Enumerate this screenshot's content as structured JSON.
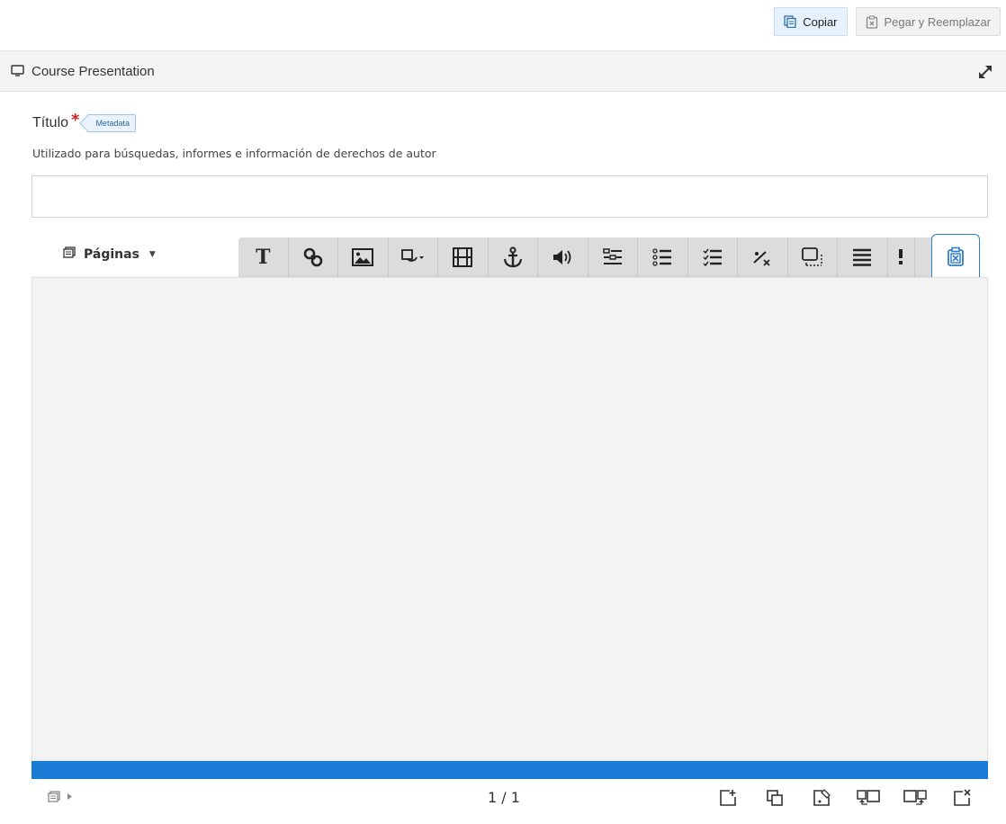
{
  "top_actions": {
    "copy_label": "Copiar",
    "paste_label": "Pegar y Reemplazar"
  },
  "header": {
    "title": "Course Presentation",
    "icon": "monitor-icon",
    "fullscreen_icon": "expand-icon"
  },
  "title_field": {
    "label": "Título",
    "required_mark": "*",
    "metadata_label": "Metadata",
    "description": "Utilizado para búsquedas, informes e información de derechos de autor",
    "value": ""
  },
  "pages_menu": {
    "label": "Páginas"
  },
  "toolbar": {
    "tools": [
      "text-icon",
      "link-icon",
      "image-icon",
      "shapes-icon",
      "video-icon",
      "anchor-icon",
      "audio-icon",
      "form-icon",
      "list-icon",
      "checklist-icon",
      "fraction-icon",
      "screen-dotted-icon",
      "table-icon",
      "more-icon",
      "paste-icon"
    ]
  },
  "footer": {
    "page_counter": "1 / 1"
  },
  "colors": {
    "accent": "#1a7cd6",
    "copy_bg": "#e6f1fb",
    "toolbar_bg": "#dcdcdc",
    "canvas_bg": "#f3f3f3"
  }
}
